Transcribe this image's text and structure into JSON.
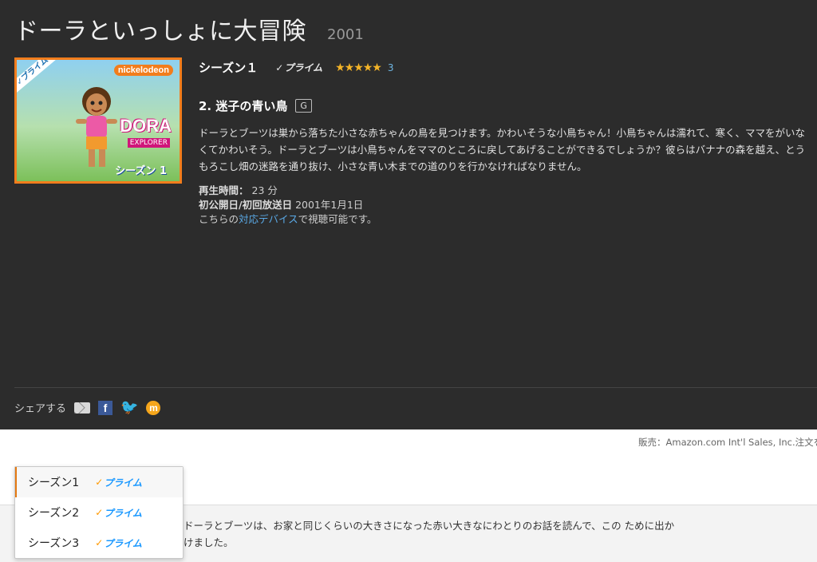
{
  "header": {
    "title": "ドーラといっしょに大冒険",
    "year": "2001"
  },
  "poster": {
    "ribbon": "✓プライム",
    "brand": "nickelodeon",
    "logo": "DORA",
    "sub": "EXPLORER",
    "season_label": "シーズン 1",
    "border_color": "#f27d1c"
  },
  "season": {
    "label": "シーズン１",
    "prime_label": "プライム",
    "stars": "★★★★★",
    "rating_count": "3"
  },
  "episode": {
    "title": "2. 迷子の青い鳥",
    "rating": "G",
    "description": "ドーラとブーツは巣から落ちた小さな赤ちゃんの鳥を見つけます。かわいそうな小鳥ちゃん！小鳥ちゃんは濡れて、寒く、ママをがいなくてかわいそう。ドーラとブーツは小鳥ちゃんをママのところに戻してあげることができるでしょうか？彼らはバナナの森を越え、とうもろこし畑の迷路を通り抜け、小さな青い木までの道のりを行かなければなりません。"
  },
  "meta": {
    "runtime_label": "再生時間：",
    "runtime_value": "23 分",
    "release_label": "初公開日/初回放送日",
    "release_value": "2001年1月1日",
    "device_prefix": "こちらの",
    "device_link": "対応デバイス",
    "device_suffix": "で視聴可能です。"
  },
  "share": {
    "label": "シェアする",
    "icons": [
      "mail-icon",
      "facebook-icon",
      "twitter-icon",
      "mixi-icon"
    ]
  },
  "seller": "販売：Amazon.com Int'l Sales, Inc.注文を",
  "dropdown": {
    "items": [
      {
        "label": "シーズン1",
        "prime": "プライム",
        "selected": true
      },
      {
        "label": "シーズン2",
        "prime": "プライム",
        "selected": false
      },
      {
        "label": "シーズン3",
        "prime": "プライム",
        "selected": false
      }
    ]
  },
  "lower_text": "ドーラとブーツは、お家と同じくらいの大きさになった赤い大きなにわとりのお話を読んで、この ために出かけました。",
  "colors": {
    "hero_bg": "#2c2c2c",
    "star": "#f4b428",
    "link": "#5aa9e6",
    "prime_blue": "#1a98ff",
    "prime_check": "#ff9900"
  }
}
